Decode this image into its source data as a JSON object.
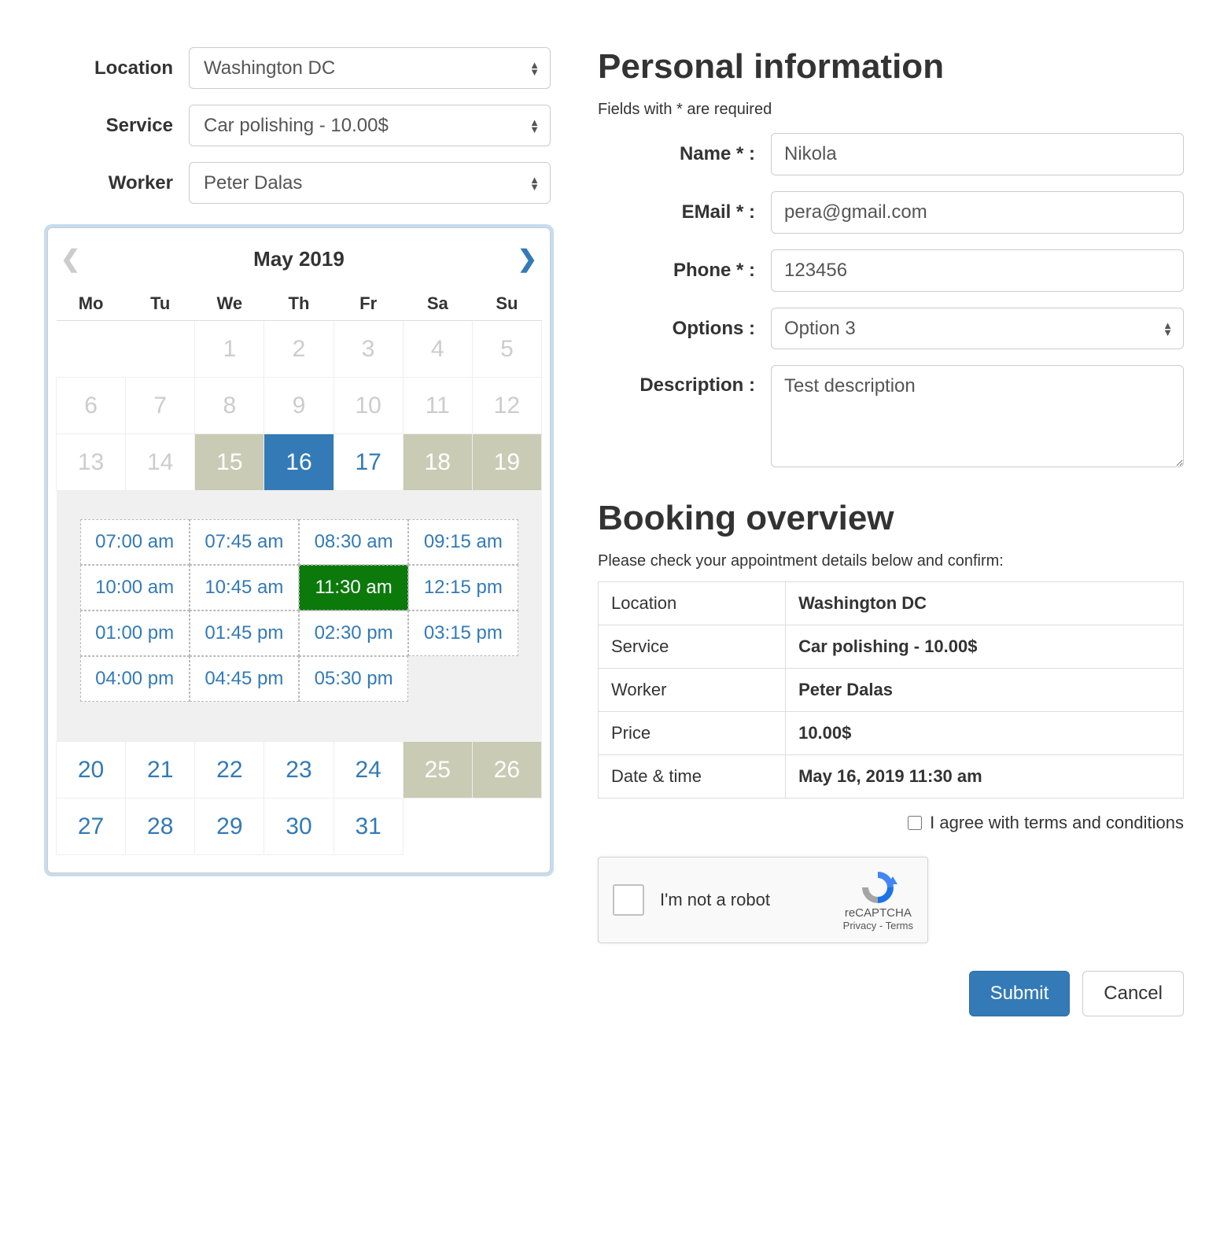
{
  "selectors": {
    "location_label": "Location",
    "location_value": "Washington DC",
    "service_label": "Service",
    "service_value": "Car polishing - 10.00$",
    "worker_label": "Worker",
    "worker_value": "Peter Dalas"
  },
  "calendar": {
    "title": "May 2019",
    "weekdays": [
      "Mo",
      "Tu",
      "We",
      "Th",
      "Fr",
      "Sa",
      "Su"
    ],
    "weeks": [
      [
        {
          "d": "",
          "state": "empty"
        },
        {
          "d": "",
          "state": "empty"
        },
        {
          "d": "1",
          "state": "past"
        },
        {
          "d": "2",
          "state": "past"
        },
        {
          "d": "3",
          "state": "past"
        },
        {
          "d": "4",
          "state": "past"
        },
        {
          "d": "5",
          "state": "past"
        }
      ],
      [
        {
          "d": "6",
          "state": "past"
        },
        {
          "d": "7",
          "state": "past"
        },
        {
          "d": "8",
          "state": "past"
        },
        {
          "d": "9",
          "state": "past"
        },
        {
          "d": "10",
          "state": "past"
        },
        {
          "d": "11",
          "state": "past"
        },
        {
          "d": "12",
          "state": "past"
        }
      ],
      [
        {
          "d": "13",
          "state": "past"
        },
        {
          "d": "14",
          "state": "past"
        },
        {
          "d": "15",
          "state": "busy"
        },
        {
          "d": "16",
          "state": "selected"
        },
        {
          "d": "17",
          "state": "avail"
        },
        {
          "d": "18",
          "state": "busy"
        },
        {
          "d": "19",
          "state": "busy"
        }
      ],
      [
        {
          "d": "20",
          "state": "avail"
        },
        {
          "d": "21",
          "state": "avail"
        },
        {
          "d": "22",
          "state": "avail"
        },
        {
          "d": "23",
          "state": "avail"
        },
        {
          "d": "24",
          "state": "avail"
        },
        {
          "d": "25",
          "state": "busy"
        },
        {
          "d": "26",
          "state": "busy"
        }
      ],
      [
        {
          "d": "27",
          "state": "avail"
        },
        {
          "d": "28",
          "state": "avail"
        },
        {
          "d": "29",
          "state": "avail"
        },
        {
          "d": "30",
          "state": "avail"
        },
        {
          "d": "31",
          "state": "avail"
        },
        {
          "d": "",
          "state": "empty"
        },
        {
          "d": "",
          "state": "empty"
        }
      ]
    ],
    "timeslots": [
      {
        "t": "07:00 am",
        "sel": false
      },
      {
        "t": "07:45 am",
        "sel": false
      },
      {
        "t": "08:30 am",
        "sel": false
      },
      {
        "t": "09:15 am",
        "sel": false
      },
      {
        "t": "10:00 am",
        "sel": false
      },
      {
        "t": "10:45 am",
        "sel": false
      },
      {
        "t": "11:30 am",
        "sel": true
      },
      {
        "t": "12:15 pm",
        "sel": false
      },
      {
        "t": "01:00 pm",
        "sel": false
      },
      {
        "t": "01:45 pm",
        "sel": false
      },
      {
        "t": "02:30 pm",
        "sel": false
      },
      {
        "t": "03:15 pm",
        "sel": false
      },
      {
        "t": "04:00 pm",
        "sel": false
      },
      {
        "t": "04:45 pm",
        "sel": false
      },
      {
        "t": "05:30 pm",
        "sel": false
      }
    ],
    "timeslot_after_week_index": 2
  },
  "personal": {
    "heading": "Personal information",
    "required_hint": "Fields with * are required",
    "name_label": "Name * :",
    "name_value": "Nikola",
    "email_label": "EMail * :",
    "email_value": "pera@gmail.com",
    "phone_label": "Phone * :",
    "phone_value": "123456",
    "options_label": "Options :",
    "options_value": "Option 3",
    "description_label": "Description :",
    "description_value": "Test description"
  },
  "overview": {
    "heading": "Booking overview",
    "hint": "Please check your appointment details below and confirm:",
    "rows": [
      {
        "k": "Location",
        "v": "Washington DC"
      },
      {
        "k": "Service",
        "v": "Car polishing - 10.00$"
      },
      {
        "k": "Worker",
        "v": "Peter Dalas"
      },
      {
        "k": "Price",
        "v": "10.00$"
      },
      {
        "k": "Date & time",
        "v": "May 16, 2019 11:30 am"
      }
    ],
    "terms_label": "I agree with terms and conditions"
  },
  "recaptcha": {
    "label": "I'm not a robot",
    "name": "reCAPTCHA",
    "links": "Privacy - Terms"
  },
  "actions": {
    "submit": "Submit",
    "cancel": "Cancel"
  }
}
